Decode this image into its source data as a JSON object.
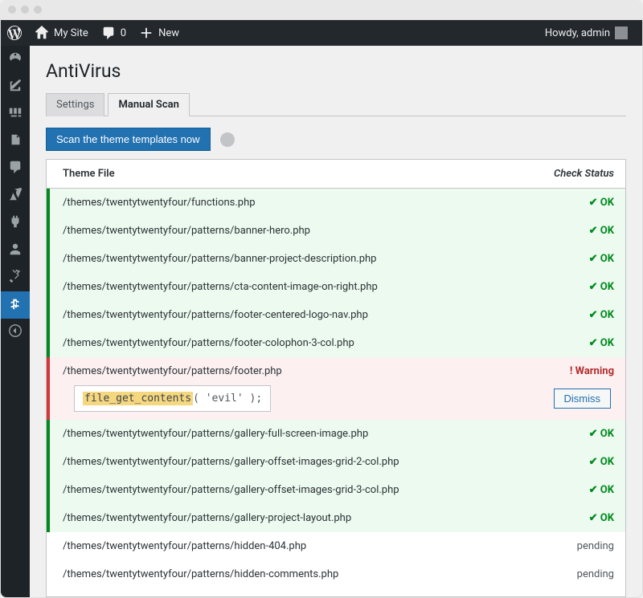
{
  "adminbar": {
    "site_name": "My Site",
    "comments_count": "0",
    "new_label": "New",
    "greeting": "Howdy, admin"
  },
  "sidebar": {
    "items": [
      {
        "name": "dashboard",
        "current": false
      },
      {
        "name": "posts",
        "current": false
      },
      {
        "name": "media",
        "current": false
      },
      {
        "name": "pages",
        "current": false
      },
      {
        "name": "comments",
        "current": false
      },
      {
        "name": "appearance",
        "current": false
      },
      {
        "name": "plugins",
        "current": false
      },
      {
        "name": "users",
        "current": false
      },
      {
        "name": "tools",
        "current": false
      },
      {
        "name": "antivirus",
        "current": true
      },
      {
        "name": "collapse",
        "current": false
      }
    ]
  },
  "page": {
    "title": "AntiVirus",
    "tabs": [
      {
        "label": "Settings",
        "active": false
      },
      {
        "label": "Manual Scan",
        "active": true
      }
    ],
    "scan_button": "Scan the theme templates now",
    "table": {
      "header_file": "Theme File",
      "header_status": "Check Status",
      "ok_label": "✔ OK",
      "warning_label": "! Warning",
      "pending_label": "pending",
      "dismiss_label": "Dismiss",
      "warning_code_highlight": "file_get_contents",
      "warning_code_tail": "( 'evil' );",
      "rows": [
        {
          "file": "/themes/twentytwentyfour/functions.php",
          "status": "ok"
        },
        {
          "file": "/themes/twentytwentyfour/patterns/banner-hero.php",
          "status": "ok"
        },
        {
          "file": "/themes/twentytwentyfour/patterns/banner-project-description.php",
          "status": "ok"
        },
        {
          "file": "/themes/twentytwentyfour/patterns/cta-content-image-on-right.php",
          "status": "ok"
        },
        {
          "file": "/themes/twentytwentyfour/patterns/footer-centered-logo-nav.php",
          "status": "ok"
        },
        {
          "file": "/themes/twentytwentyfour/patterns/footer-colophon-3-col.php",
          "status": "ok"
        },
        {
          "file": "/themes/twentytwentyfour/patterns/footer.php",
          "status": "warning"
        },
        {
          "file": "/themes/twentytwentyfour/patterns/gallery-full-screen-image.php",
          "status": "ok"
        },
        {
          "file": "/themes/twentytwentyfour/patterns/gallery-offset-images-grid-2-col.php",
          "status": "ok"
        },
        {
          "file": "/themes/twentytwentyfour/patterns/gallery-offset-images-grid-3-col.php",
          "status": "ok"
        },
        {
          "file": "/themes/twentytwentyfour/patterns/gallery-project-layout.php",
          "status": "ok"
        },
        {
          "file": "/themes/twentytwentyfour/patterns/hidden-404.php",
          "status": "pending"
        },
        {
          "file": "/themes/twentytwentyfour/patterns/hidden-comments.php",
          "status": "pending"
        }
      ]
    }
  }
}
